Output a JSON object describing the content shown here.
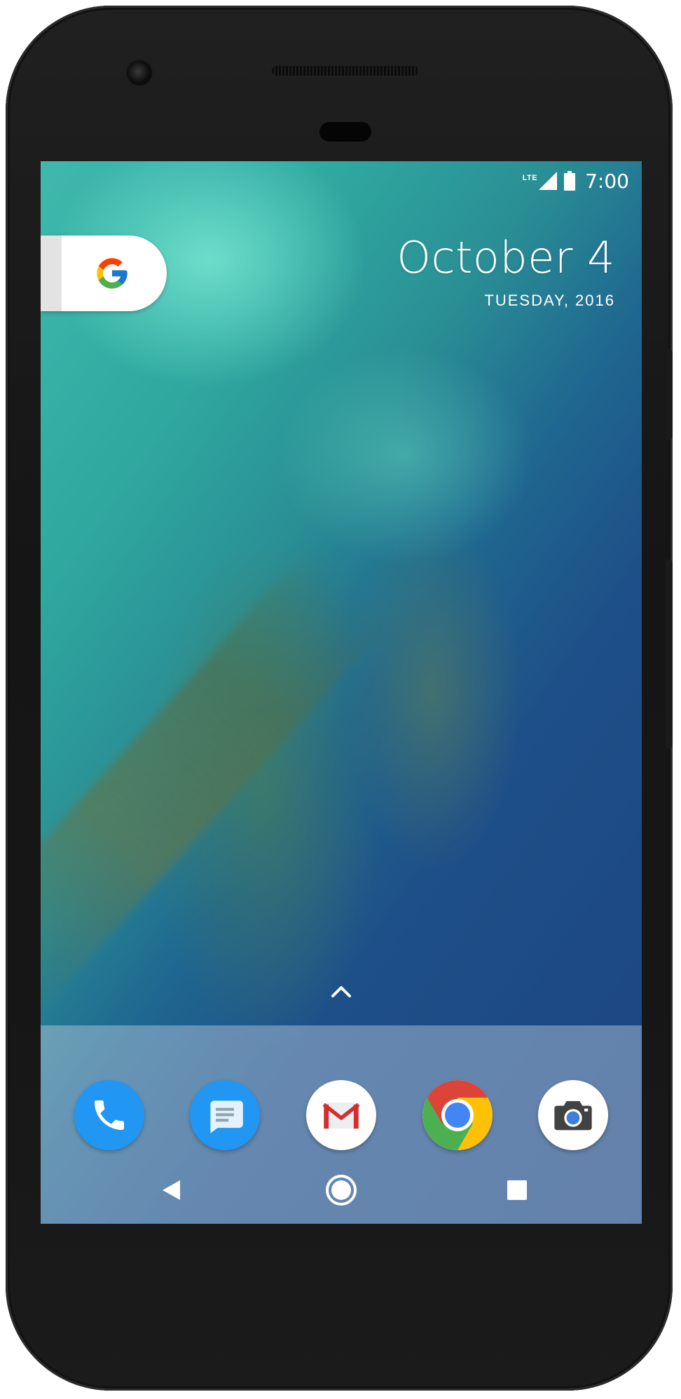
{
  "status_bar": {
    "network": "LTE",
    "time": "7:00",
    "icons": [
      "signal-icon",
      "battery-icon"
    ]
  },
  "search_widget": {
    "icon": "google-g-icon"
  },
  "date_widget": {
    "date": "October 4",
    "weekday_year": "TUESDAY, 2016"
  },
  "app_drawer": {
    "icon": "chevron-up-icon"
  },
  "dock": {
    "apps": [
      {
        "name": "Phone",
        "icon": "phone-icon",
        "color": "#2196F3"
      },
      {
        "name": "Messages",
        "icon": "messages-icon",
        "color": "#2196F3"
      },
      {
        "name": "Gmail",
        "icon": "gmail-icon",
        "color": "#DB4437"
      },
      {
        "name": "Chrome",
        "icon": "chrome-icon",
        "color": "#4285F4"
      },
      {
        "name": "Camera",
        "icon": "camera-icon",
        "color": "#424242"
      }
    ]
  },
  "navigation": {
    "buttons": [
      "back-icon",
      "home-icon",
      "recents-icon"
    ]
  },
  "colors": {
    "wallpaper_shallow": "#3fb9ac",
    "wallpaper_deep": "#1c4480",
    "phone_body": "#161616"
  }
}
